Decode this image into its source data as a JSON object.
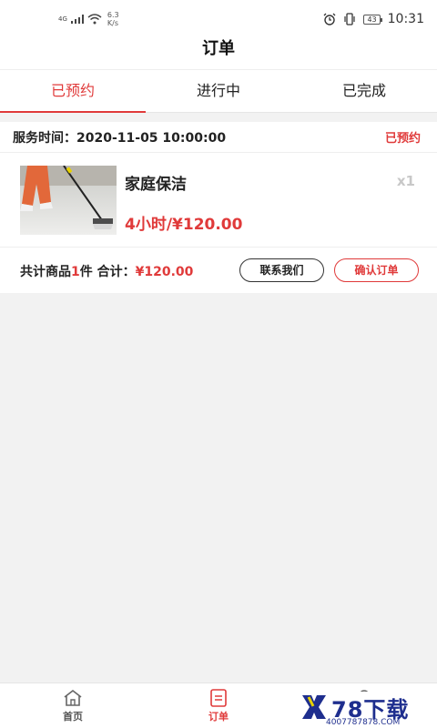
{
  "status_bar": {
    "network": "4G",
    "speed_value": "6.3",
    "speed_unit": "K/s",
    "battery": "43",
    "time": "10:31"
  },
  "title": "订单",
  "tabs": [
    {
      "label": "已预约",
      "active": true
    },
    {
      "label": "进行中",
      "active": false
    },
    {
      "label": "已完成",
      "active": false
    }
  ],
  "order": {
    "service_time": "服务时间：2020-11-05 10:00:00",
    "status": "已预约",
    "item": {
      "name": "家庭保洁",
      "qty": "x1",
      "price": "4小时/¥120.00"
    },
    "summary_prefix": "共计商品",
    "summary_count": "1",
    "summary_mid": "件 合计：",
    "summary_total": "¥120.00",
    "contact_button": "联系我们",
    "confirm_button": "确认订单"
  },
  "bottom_nav": [
    {
      "label": "首页",
      "icon": "home-icon",
      "active": false
    },
    {
      "label": "订单",
      "icon": "order-icon",
      "active": true
    },
    {
      "label": "",
      "icon": "profile-icon",
      "active": false
    }
  ],
  "watermark": {
    "brand": "78下载",
    "url": "4007787878.COM"
  },
  "colors": {
    "accent": "#e03a3a",
    "muted": "#c8c8c8",
    "watermark": "#1e2e8e"
  }
}
